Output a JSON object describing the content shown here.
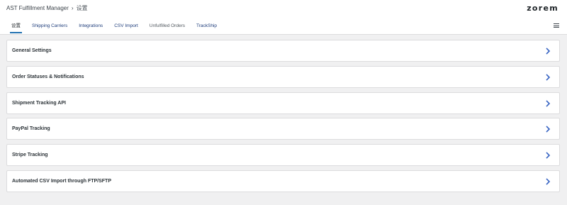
{
  "header": {
    "breadcrumb": {
      "parent": "AST Fulfillment Manager",
      "separator": "›",
      "current": "设置"
    },
    "logo": "zorem"
  },
  "tabs": [
    {
      "label": "设置",
      "active": true
    },
    {
      "label": "Shipping Carriers",
      "active": false
    },
    {
      "label": "Integrations",
      "active": false
    },
    {
      "label": "CSV Import",
      "active": false
    },
    {
      "label": "Unfulfilled Orders",
      "active": false
    },
    {
      "label": "TrackShip",
      "active": false
    }
  ],
  "menu_icon": "hamburger-menu-icon",
  "sections": [
    {
      "title": "General Settings",
      "icon": "chevron-right-icon"
    },
    {
      "title": "Order Statuses & Notifications",
      "icon": "chevron-right-icon"
    },
    {
      "title": "Shipment Tracking API",
      "icon": "chevron-right-icon"
    },
    {
      "title": "PayPal Tracking",
      "icon": "chevron-right-icon"
    },
    {
      "title": "Stripe Tracking",
      "icon": "chevron-right-icon"
    },
    {
      "title": "Automated CSV Import through FTP/SFTP",
      "icon": "chevron-right-icon"
    }
  ],
  "colors": {
    "accent": "#2271b1",
    "chevron": "#3a66c4",
    "page_bg": "#f0f0f1",
    "panel_bg": "#ffffff"
  }
}
